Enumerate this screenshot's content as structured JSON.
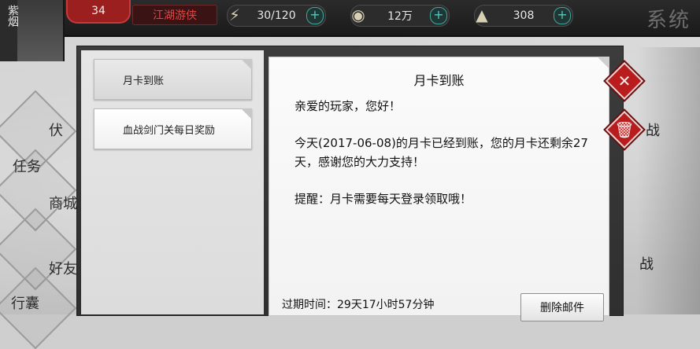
{
  "player": {
    "name": "紫烟",
    "level": "34",
    "title": "江湖游侠"
  },
  "resources": {
    "stamina": {
      "icon": "lightning-icon",
      "value": "30/120"
    },
    "coins": {
      "icon": "coin-icon",
      "value": "12万"
    },
    "ingots": {
      "icon": "ingot-icon",
      "value": "308"
    }
  },
  "corner": {
    "label": "系统"
  },
  "side_menu": [
    "伏",
    "任务",
    "商城",
    "好友",
    "行囊"
  ],
  "mail_list": [
    {
      "label": "月卡到账",
      "selected": true
    },
    {
      "label": "血战剑门关每日奖励",
      "selected": false
    }
  ],
  "mail": {
    "title": "月卡到账",
    "greeting": "亲爱的玩家，您好！",
    "body": "今天(2017-06-08)的月卡已经到账，您的月卡还剩余27天，感谢您的大力支持！",
    "reminder": "提醒：月卡需要每天登录领取哦！",
    "expire_label": "过期时间：29天17小时57分钟",
    "delete_label": "删除邮件"
  },
  "actions": {
    "close": "close-icon",
    "trash": "trash-icon"
  },
  "right_menu": [
    "战",
    "战"
  ]
}
